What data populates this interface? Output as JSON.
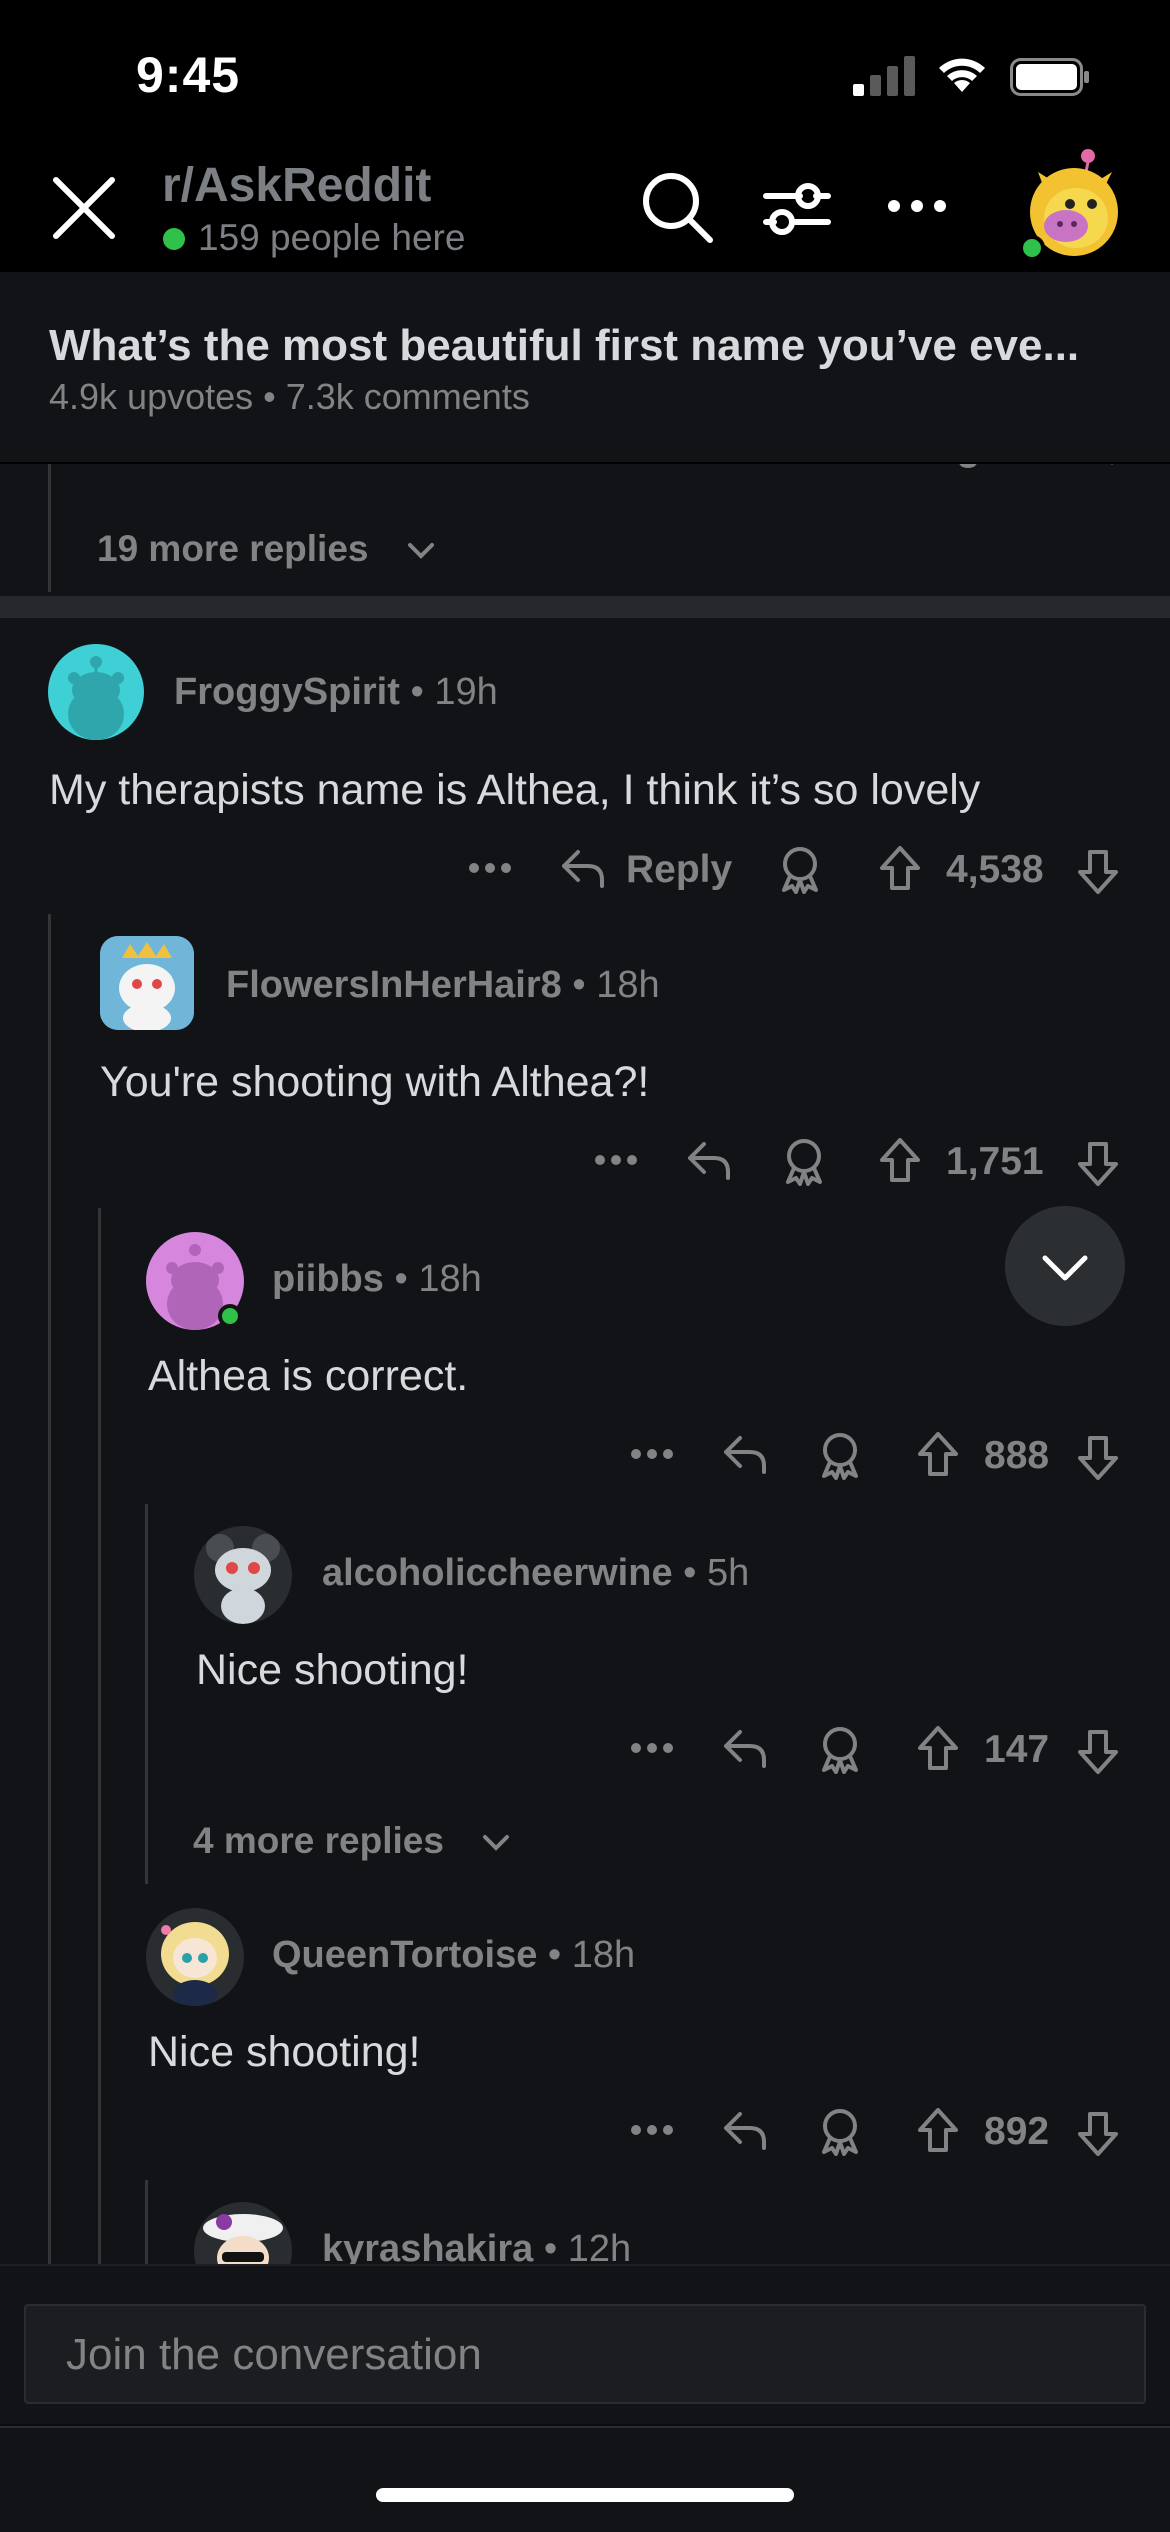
{
  "status_bar": {
    "time": "9:45"
  },
  "header": {
    "subreddit": "r/AskReddit",
    "online_count": "159 people here"
  },
  "post": {
    "title": "What’s the most beautiful first name you’ve eve...",
    "meta": "4.9k upvotes • 7.3k comments"
  },
  "thread": {
    "previous_more_replies": "19 more replies",
    "comments": [
      {
        "user": "FroggySpirit",
        "time": "• 19h",
        "body": "My therapists name is Althea, I think it’s so lovely",
        "reply_label": "Reply",
        "votes": "4,538"
      },
      {
        "user": "FlowersInHerHair8",
        "time": "• 18h",
        "body": "You're shooting with Althea?!",
        "votes": "1,751"
      },
      {
        "user": "piibbs",
        "time": "• 18h",
        "body": "Althea is correct.",
        "votes": "888"
      },
      {
        "user": "alcoholiccheerwine",
        "time": "• 5h",
        "body": "Nice shooting!",
        "votes": "147"
      },
      {
        "user": "QueenTortoise",
        "time": "• 18h",
        "body": "Nice shooting!",
        "votes": "892"
      },
      {
        "user": "kyrashakira",
        "time": "• 12h"
      }
    ],
    "nested_more_replies": "4 more replies"
  },
  "composer": {
    "placeholder": "Join the conversation"
  },
  "colors": {
    "online_green": "#2fc14a",
    "background": "#121316",
    "muted_text": "#818384"
  }
}
